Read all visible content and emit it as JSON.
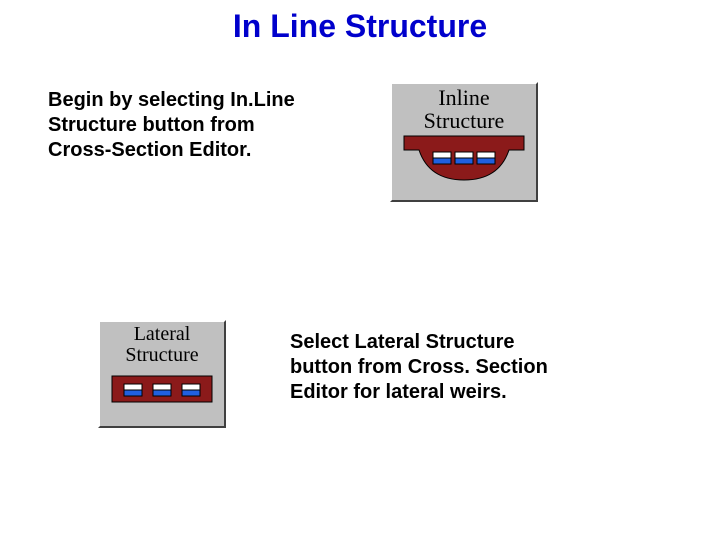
{
  "title": "In Line Structure",
  "para1": "Begin by selecting In.Line Structure button from Cross-Section Editor.",
  "para2": "Select Lateral Structure button from Cross. Section Editor for lateral weirs.",
  "icon1": {
    "line1": "Inline",
    "line2": "Structure"
  },
  "icon2": {
    "line1": "Lateral",
    "line2": "Structure"
  }
}
